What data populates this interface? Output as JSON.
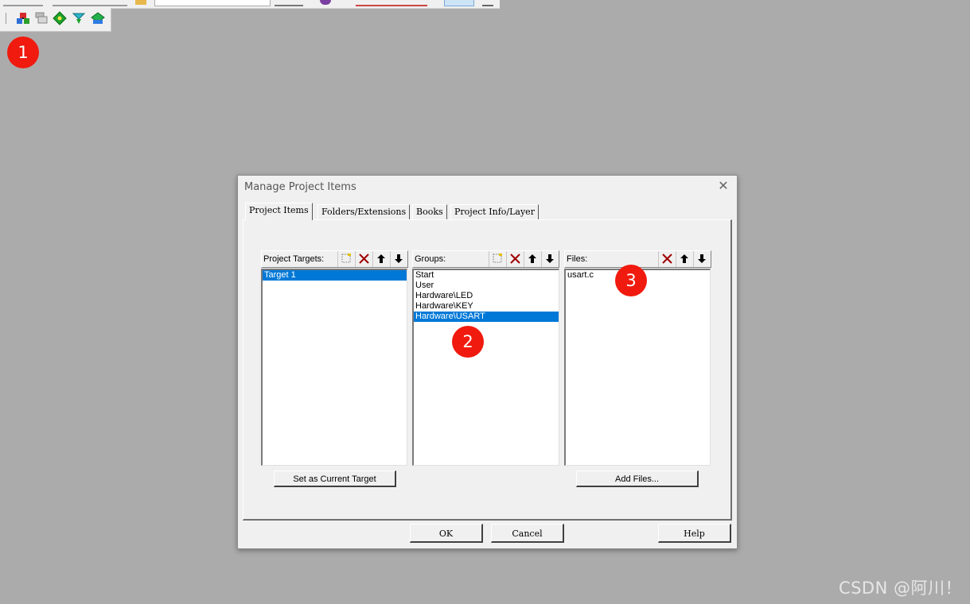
{
  "dialog": {
    "title": "Manage Project Items",
    "close_glyph": "✕",
    "tabs": [
      {
        "label": "Project Items",
        "active": true
      },
      {
        "label": "Folders/Extensions",
        "active": false
      },
      {
        "label": "Books",
        "active": false
      },
      {
        "label": "Project Info/Layer",
        "active": false
      }
    ],
    "targets": {
      "label": "Project Targets:",
      "items": [
        "Target 1"
      ],
      "selected_index": 0,
      "button_label": "Set as Current Target"
    },
    "groups": {
      "label": "Groups:",
      "items": [
        "Start",
        "User",
        "Hardware\\LED",
        "Hardware\\KEY",
        "Hardware\\USART"
      ],
      "selected_index": 4
    },
    "files": {
      "label": "Files:",
      "items": [
        "usart.c"
      ],
      "button_label": "Add Files..."
    },
    "footer": {
      "ok_label": "OK",
      "cancel_label": "Cancel",
      "help_label": "Help"
    }
  },
  "markers": [
    "1",
    "2",
    "3"
  ],
  "watermark": "CSDN @阿川！",
  "colors": {
    "selection": "#0078d7",
    "marker": "#f01a0e",
    "background": "#ababab",
    "delete_icon": "#a00000"
  },
  "icons": {
    "toolbar": [
      "manage-project-items-icon",
      "target-options-icon",
      "target-icon",
      "translate-icon",
      "pack-installer-icon"
    ],
    "list_header": [
      "new-item-icon",
      "delete-icon",
      "move-up-icon",
      "move-down-icon"
    ]
  }
}
